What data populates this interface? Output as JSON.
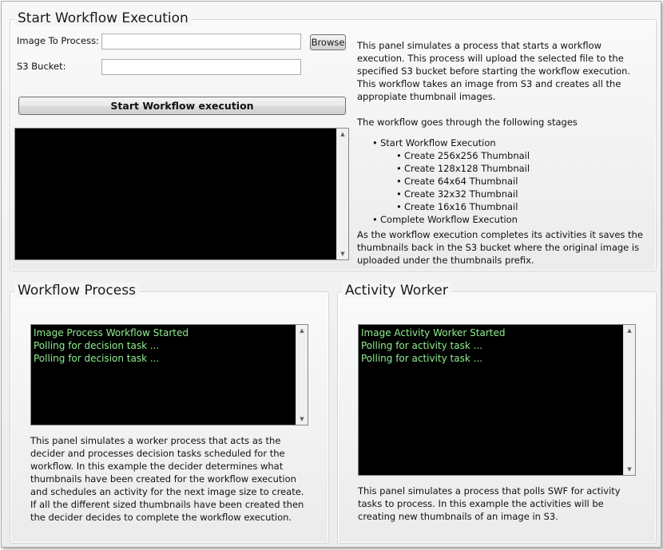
{
  "start_panel": {
    "title": "Start Workflow Execution",
    "image_label": "Image To Process:",
    "image_value": "",
    "browse_label": "Browse",
    "bucket_label": "S3 Bucket:",
    "bucket_value": "",
    "start_button": "Start Workflow execution",
    "console_lines": [],
    "description": "This panel simulates a process that starts a workflow execution. This process will upload the selected file to the specified S3 bucket before starting the workflow execution. This workflow takes an image from S3 and creates all the appropiate thumbnail images.",
    "stages_intro": "The workflow goes through the following stages",
    "stage_start": "Start Workflow Execution",
    "sub_stages": [
      "Create 256x256 Thumbnail",
      "Create 128x128 Thumbnail",
      "Create 64x64 Thumbnail",
      "Create 32x32 Thumbnail",
      "Create 16x16 Thumbnail"
    ],
    "stage_complete": "Complete Workflow Execution",
    "completion_note": "As the workflow execution completes its activities it saves the thumbnails back in the S3 bucket where the original image is uploaded under the thumbnails prefix."
  },
  "workflow_panel": {
    "title": "Workflow Process",
    "console_lines": [
      "Image Process Workflow Started",
      "Polling for decision task ...",
      "Polling for decision task ..."
    ],
    "description": "This panel simulates a worker process that acts as the decider and processes decision tasks scheduled for the workflow. In this example the decider determines what thumbnails have been created for the workflow execution and schedules an activity for the next image size to create. If all the different sized thumbnails have been created then the decider decides to complete the workflow execution."
  },
  "activity_panel": {
    "title": "Activity Worker",
    "console_lines": [
      "Image Activity Worker Started",
      "Polling for activity task ...",
      "Polling for activity task ..."
    ],
    "description": "This panel simulates a process that polls SWF for activity tasks to process. In this example the activities will be creating new thumbnails of an image in S3."
  },
  "icons": {
    "scroll_up": "scroll-up-arrow-icon",
    "scroll_down": "scroll-down-arrow-icon"
  },
  "colors": {
    "console_background": "#000000",
    "console_text": "#90ee90"
  }
}
